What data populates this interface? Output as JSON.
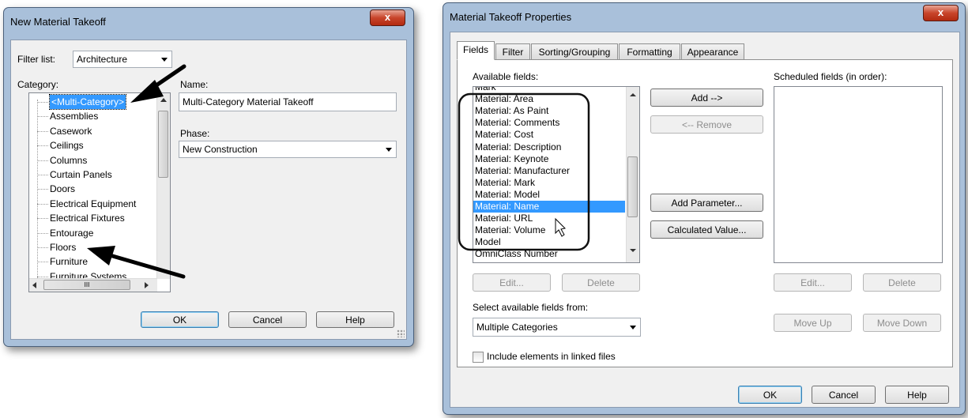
{
  "dialog1": {
    "title": "New Material Takeoff",
    "close_glyph": "x",
    "filter_label": "Filter list:",
    "filter_value": "Architecture",
    "category_label": "Category:",
    "categories": [
      "<Multi-Category>",
      "Assemblies",
      "Casework",
      "Ceilings",
      "Columns",
      "Curtain Panels",
      "Doors",
      "Electrical Equipment",
      "Electrical Fixtures",
      "Entourage",
      "Floors",
      "Furniture",
      "Furniture Systems"
    ],
    "selected_category": "<Multi-Category>",
    "hscroll_glyph": "III",
    "name_label": "Name:",
    "name_value": "Multi-Category Material Takeoff",
    "phase_label": "Phase:",
    "phase_value": "New Construction",
    "ok": "OK",
    "cancel": "Cancel",
    "help": "Help"
  },
  "dialog2": {
    "title": "Material Takeoff Properties",
    "close_glyph": "x",
    "tabs": [
      "Fields",
      "Filter",
      "Sorting/Grouping",
      "Formatting",
      "Appearance"
    ],
    "active_tab": "Fields",
    "available_label": "Available fields:",
    "available_fields": [
      "Mark",
      "Material: Area",
      "Material: As Paint",
      "Material: Comments",
      "Material: Cost",
      "Material: Description",
      "Material: Keynote",
      "Material: Manufacturer",
      "Material: Mark",
      "Material: Model",
      "Material: Name",
      "Material: URL",
      "Material: Volume",
      "Model",
      "OmniClass Number"
    ],
    "selected_field": "Material: Name",
    "add": "Add -->",
    "remove": "<-- Remove",
    "add_parameter": "Add Parameter...",
    "calculated_value": "Calculated Value...",
    "scheduled_label": "Scheduled fields (in order):",
    "edit_left": "Edit...",
    "delete_left": "Delete",
    "edit_right": "Edit...",
    "delete_right": "Delete",
    "select_from_label": "Select available fields from:",
    "select_from_value": "Multiple Categories",
    "move_up": "Move Up",
    "move_down": "Move Down",
    "include_linked": "Include elements in linked files",
    "ok": "OK",
    "cancel": "Cancel",
    "help": "Help"
  },
  "colors": {
    "selection": "#3399ff",
    "window_frame": "#a9c0da",
    "close_red": "#c8452b",
    "annotation_arrow": "#000000"
  }
}
